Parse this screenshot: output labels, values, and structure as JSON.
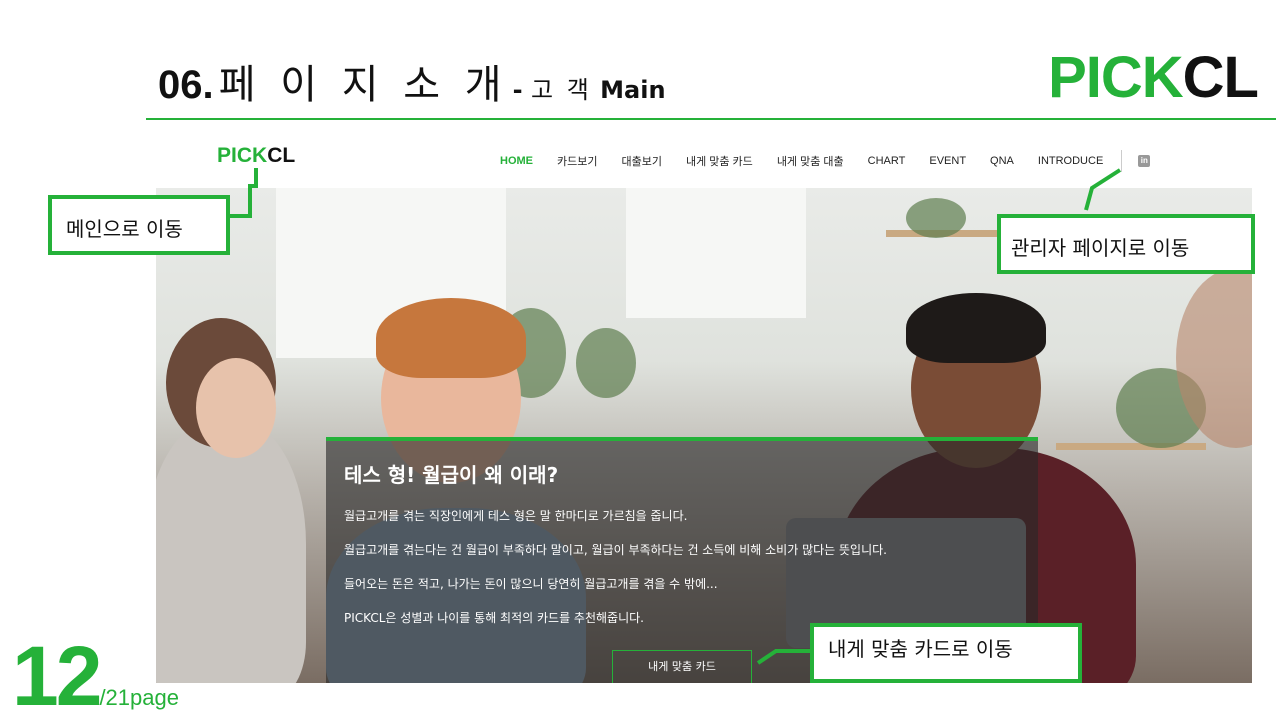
{
  "slide": {
    "number": "06.",
    "title": "페 이 지  소 개",
    "sub_dash": "- ",
    "sub_korean": "고 객",
    "sub_english": "Main"
  },
  "brand": {
    "part1": "PICK",
    "part2": "CL"
  },
  "site": {
    "logo": {
      "part1": "PICK",
      "part2": "CL"
    },
    "nav": [
      {
        "label": "HOME",
        "active": true
      },
      {
        "label": "카드보기"
      },
      {
        "label": "대출보기"
      },
      {
        "label": "내게 맞춤 카드"
      },
      {
        "label": "내게 맞춤 대출"
      },
      {
        "label": "CHART"
      },
      {
        "label": "EVENT"
      },
      {
        "label": "QNA"
      },
      {
        "label": "INTRODUCE"
      }
    ],
    "admin_icon": "linkedin-icon",
    "hero": {
      "heading": "테스 형! 월급이 왜 이래?",
      "lines": [
        "월급고개를 겪는 직장인에게 테스 형은 말 한마디로 가르침을 줍니다.",
        "월급고개를 겪는다는 건 월급이 부족하다 말이고, 월급이 부족하다는 건 소득에 비해 소비가 많다는 뜻입니다.",
        "들어오는 돈은 적고, 나가는 돈이 많으니 당연히 월급고개를 겪을 수 밖에...",
        "PICKCL은 성별과 나이를 통해 최적의 카드를 추천해줍니다."
      ],
      "button": "내게 맞춤 카드"
    }
  },
  "callouts": {
    "main": "메인으로 이동",
    "admin": "관리자 페이지로 이동",
    "card": "내게 맞춤 카드로 이동"
  },
  "page": {
    "current": "12",
    "total": "/21page"
  },
  "colors": {
    "accent": "#25b139",
    "text": "#111111"
  }
}
